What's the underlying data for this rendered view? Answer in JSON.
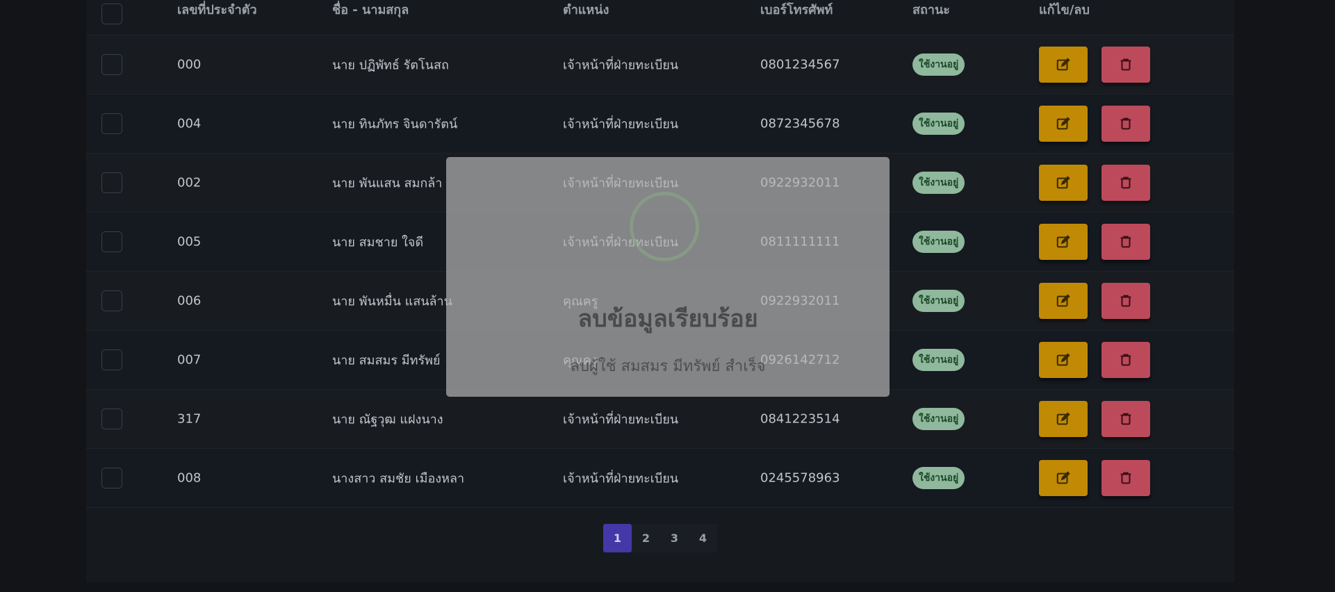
{
  "table": {
    "headers": {
      "id": "เลขที่ประจำตัว",
      "name": "ชื่อ - นามสกุล",
      "position": "ตำแหน่ง",
      "phone": "เบอร์โทรศัพท์",
      "status": "สถานะ",
      "actions": "แก้ไข/ลบ"
    },
    "rows": [
      {
        "id": "000",
        "name": "นาย ปฏิพัทธ์  รัตโนสถ",
        "position": "เจ้าหน้าที่ฝ่ายทะเบียน",
        "phone": "0801234567",
        "status": "ใช้งานอยู่"
      },
      {
        "id": "004",
        "name": "นาย ทินภัทร  จินดารัตน์",
        "position": "เจ้าหน้าที่ฝ่ายทะเบียน",
        "phone": "0872345678",
        "status": "ใช้งานอยู่"
      },
      {
        "id": "002",
        "name": "นาย พันแสน  สมกล้า",
        "position": "เจ้าหน้าที่ฝ่ายทะเบียน",
        "phone": "0922932011",
        "status": "ใช้งานอยู่"
      },
      {
        "id": "005",
        "name": "นาย สมชาย  ใจดี",
        "position": "เจ้าหน้าที่ฝ่ายทะเบียน",
        "phone": "0811111111",
        "status": "ใช้งานอยู่"
      },
      {
        "id": "006",
        "name": "นาย พันหมื่น  แสนล้าน",
        "position": "คุณครู",
        "phone": "0922932011",
        "status": "ใช้งานอยู่"
      },
      {
        "id": "007",
        "name": "นาย สมสมร  มีทรัพย์",
        "position": "คุณครู",
        "phone": "0926142712",
        "status": "ใช้งานอยู่"
      },
      {
        "id": "317",
        "name": "นาย ณัฐวุฒ  แฝงนาง",
        "position": "เจ้าหน้าที่ฝ่ายทะเบียน",
        "phone": "0841223514",
        "status": "ใช้งานอยู่"
      },
      {
        "id": "008",
        "name": "นางสาว สมชัย  เมืองหลา",
        "position": "เจ้าหน้าที่ฝ่ายทะเบียน",
        "phone": "0245578963",
        "status": "ใช้งานอยู่"
      }
    ]
  },
  "pagination": {
    "pages": [
      "1",
      "2",
      "3",
      "4"
    ],
    "current": "1"
  },
  "modal": {
    "title": "ลบข้อมูลเรียบร้อย",
    "message": "ลบผู้ใช้ สมสมร มีทรัพย์ สำเร็จ"
  },
  "icons": {
    "edit": "edit-icon",
    "delete": "trash-icon"
  },
  "colors": {
    "edit_button": "#c08a05",
    "delete_button": "#bd4a5b",
    "status_badge": "#8fb89c",
    "active_page": "#4438a8"
  }
}
